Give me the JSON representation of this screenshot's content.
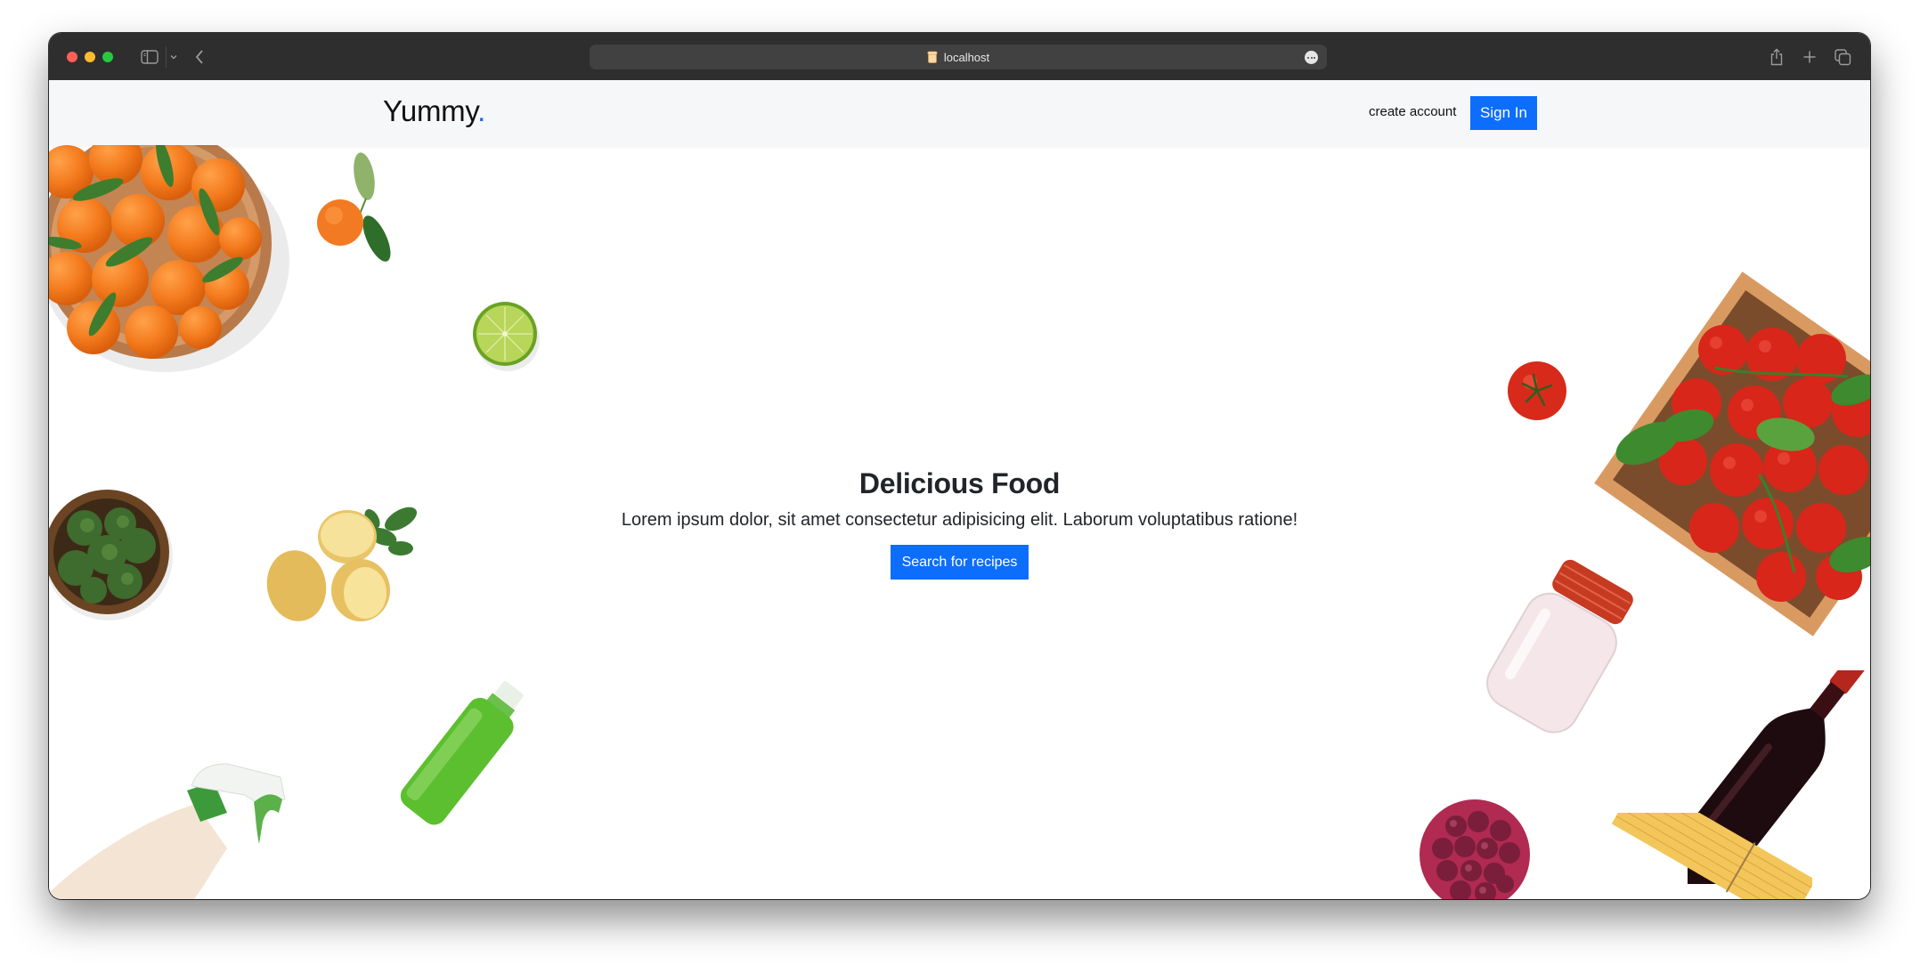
{
  "browser": {
    "url": "localhost",
    "window_controls": [
      "close",
      "minimize",
      "zoom"
    ],
    "toolbar_icons": {
      "sidebar": "sidebar-icon",
      "sidebar_menu": "chevron-down-icon",
      "back": "chevron-left-icon",
      "page_menu": "ellipsis-icon",
      "share": "share-icon",
      "new_tab": "plus-icon",
      "tabs_overview": "tabs-icon"
    }
  },
  "navbar": {
    "brand": "Yummy",
    "brand_dot": ".",
    "brand_accent_color": "#1a62f5",
    "create_account_label": "create account",
    "sign_in_label": "Sign In"
  },
  "hero": {
    "title": "Delicious Food",
    "text": "Lorem ipsum dolor, sit amet consectetur adipisicing elit. Laborum voluptatibus ratione!",
    "search_button_label": "Search for recipes",
    "primary_color": "#0d6efd",
    "decorations_left": [
      "basket-of-oranges",
      "orange-with-leaves",
      "lime-half",
      "broccoli-bowl",
      "potatoes",
      "spray-bottle",
      "green-bottle"
    ],
    "decorations_right": [
      "tomato",
      "tomato-crate",
      "sugar-jar",
      "wine-bottle",
      "grapes-bowl",
      "spaghetti"
    ]
  }
}
